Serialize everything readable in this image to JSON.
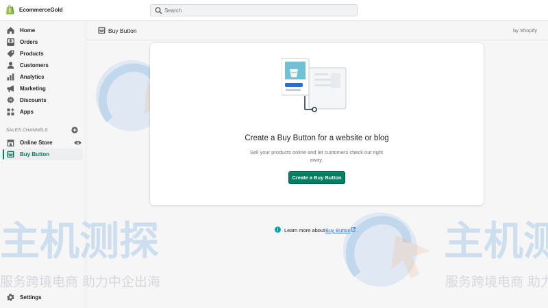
{
  "app": {
    "store_name": "EcommerceGold",
    "search_placeholder": "Search"
  },
  "sidebar": {
    "items": [
      {
        "label": "Home",
        "icon": "home-icon"
      },
      {
        "label": "Orders",
        "icon": "orders-icon"
      },
      {
        "label": "Products",
        "icon": "tag-icon"
      },
      {
        "label": "Customers",
        "icon": "person-icon"
      },
      {
        "label": "Analytics",
        "icon": "chart-icon"
      },
      {
        "label": "Marketing",
        "icon": "megaphone-icon"
      },
      {
        "label": "Discounts",
        "icon": "discount-icon"
      },
      {
        "label": "Apps",
        "icon": "apps-icon"
      }
    ],
    "sales_channels_title": "SALES CHANNELS",
    "channels": [
      {
        "label": "Online Store",
        "icon": "store-icon"
      },
      {
        "label": "Buy Button",
        "icon": "buy-button-icon"
      }
    ],
    "settings_label": "Settings"
  },
  "header": {
    "title": "Buy Button",
    "by_label": "by Shopify"
  },
  "card": {
    "title": "Create a Buy Button for a website or blog",
    "description": "Sell your products online and let customers check out right away.",
    "button_label": "Create a Buy Button"
  },
  "learn_more": {
    "text": "Learn more about",
    "link": "Buy Button",
    "suffix": "."
  },
  "watermark": {
    "brand": "主机测探",
    "slogan": "服务跨境电商 助力中企出海"
  },
  "colors": {
    "accent": "#008060",
    "link": "#2c6ecb",
    "info": "#00a0ac"
  }
}
